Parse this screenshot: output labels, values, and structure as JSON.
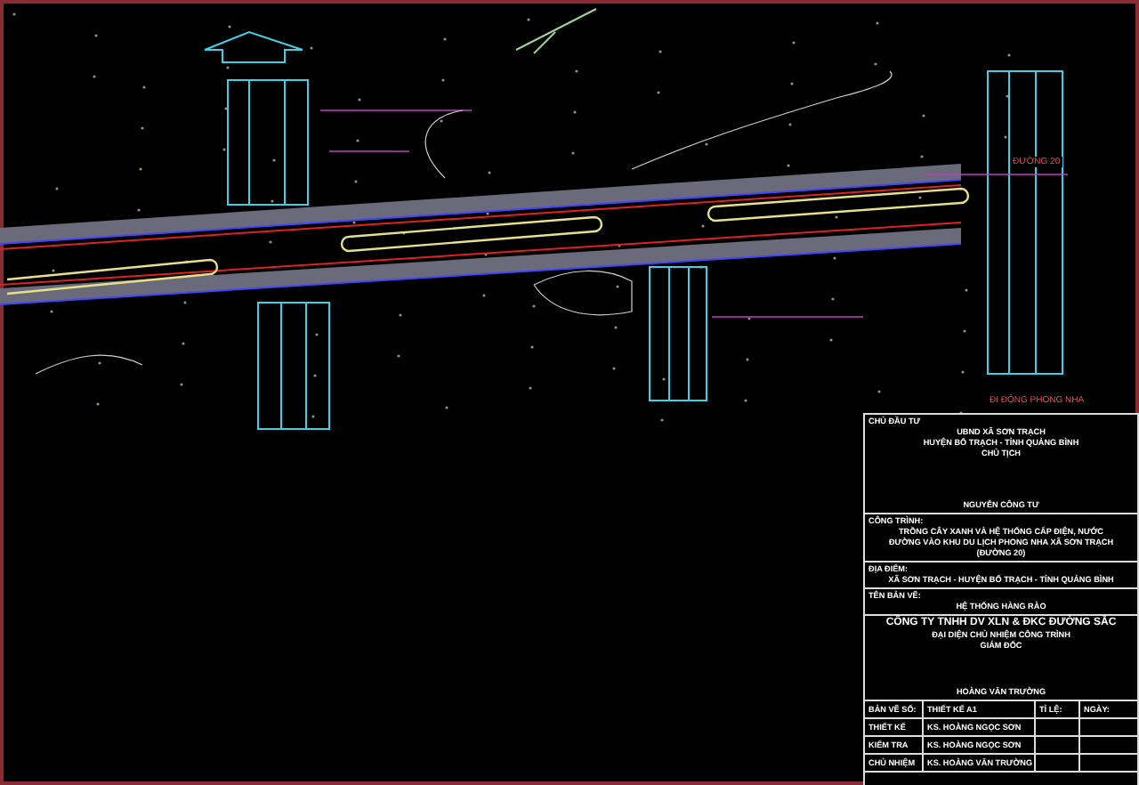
{
  "drawing": {
    "labels": [
      {
        "text": "ĐƯỜNG 20"
      },
      {
        "text": "ĐI ĐỘNG PHONG NHA"
      }
    ]
  },
  "title_block": {
    "owner": {
      "label": "CHỦ ĐẦU TƯ",
      "lines": [
        "UBND XÃ SƠN TRẠCH",
        "HUYỆN BỐ TRẠCH - TỈNH QUẢNG BÌNH",
        "CHỦ TỊCH"
      ],
      "signer": "NGUYỄN CÔNG TƯ"
    },
    "project": {
      "label": "CÔNG TRÌNH:",
      "lines": [
        "TRỒNG CÂY XANH VÀ HỆ THỐNG CẤP ĐIỆN, NƯỚC",
        "ĐƯỜNG VÀO KHU DU LỊCH PHONG NHA XÃ SƠN TRẠCH",
        "(ĐƯỜNG 20)"
      ]
    },
    "location": {
      "label": "ĐỊA ĐIỂM:",
      "text": "XÃ SƠN TRẠCH - HUYỆN BỐ TRẠCH - TỈNH QUẢNG BÌNH"
    },
    "sheet": {
      "label": "TÊN BẢN VẼ:",
      "text": "HỆ THỐNG HÀNG RÀO"
    },
    "company": {
      "name": "CÔNG TY TNHH DV XLN & ĐKC ĐƯỜNG SẮC",
      "note": "ĐẠI DIỆN CHỦ NHIỆM CÔNG TRÌNH",
      "role": "GIÁM ĐỐC",
      "signer": "HOÀNG VĂN TRƯỜNG"
    },
    "rows": [
      [
        "BẢN VẼ SỐ:",
        "THIẾT KẾ A1",
        "TỈ LỆ:",
        "NGÀY:"
      ],
      [
        "THIẾT KẾ",
        "KS. HOÀNG NGỌC SƠN",
        "",
        ""
      ],
      [
        "KIỂM TRA",
        "KS. HOÀNG NGỌC SƠN",
        "",
        ""
      ],
      [
        "CHỦ NHIỆM",
        "KS. HOÀNG VĂN TRƯỜNG",
        "",
        ""
      ]
    ]
  }
}
